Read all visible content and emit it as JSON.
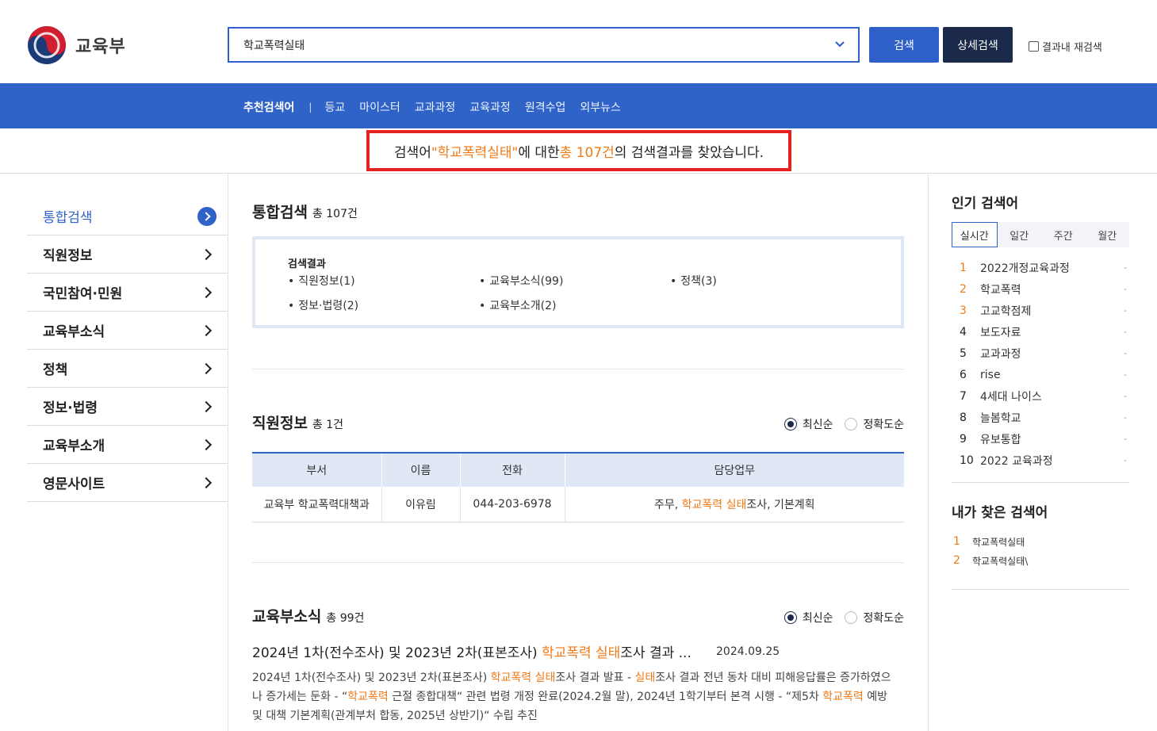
{
  "header": {
    "logo_text": "교육부",
    "search_value": "학교폭력실태",
    "search_button": "검색",
    "detail_button": "상세검색",
    "re_search_label": "결과내 재검색"
  },
  "nav": {
    "recommend_label": "추천검색어",
    "separator": "|",
    "keywords": [
      "등교",
      "마이스터",
      "교과과정",
      "교육과정",
      "원격수업",
      "외부뉴스"
    ]
  },
  "summary": {
    "prefix": "검색어 ",
    "query": "\"학교폭력실태\"",
    "mid": "에 대한 ",
    "total": "총 107건",
    "suffix": "의 검색결과를 찾았습니다."
  },
  "sidebar": {
    "items": [
      {
        "label": "통합검색"
      },
      {
        "label": "직원정보"
      },
      {
        "label": "국민참여·민원"
      },
      {
        "label": "교육부소식"
      },
      {
        "label": "정책"
      },
      {
        "label": "정보·법령"
      },
      {
        "label": "교육부소개"
      },
      {
        "label": "영문사이트"
      }
    ]
  },
  "integrated": {
    "title": "통합검색",
    "count": "총  107건",
    "box_title": "검색결과",
    "results": [
      "직원정보(1)",
      "교육부소식(99)",
      "정책(3)",
      "정보·법령(2)",
      "교육부소개(2)"
    ]
  },
  "staff": {
    "title": "직원정보",
    "count": "총  1건",
    "sort_latest": "최신순",
    "sort_accuracy": "정확도순",
    "headers": [
      "부서",
      "이름",
      "전화",
      "담당업무"
    ],
    "row": {
      "dept": "교육부 학교폭력대책과",
      "name": "이유림",
      "phone": "044-203-6978",
      "duty_pre": "주무, ",
      "duty_hl1": "학교폭력",
      "duty_sp": " ",
      "duty_hl2": "실태",
      "duty_post": "조사, 기본계획"
    }
  },
  "news": {
    "title": "교육부소식",
    "count": "총  99건",
    "sort_latest": "최신순",
    "sort_accuracy": "정확도순",
    "item_title_pre": "2024년 1차(전수조사) 및 2023년 2차(표본조사) ",
    "item_title_hl1": "학교폭력",
    "item_title_sp": " ",
    "item_title_hl2": "실태",
    "item_title_post": "조사 결과 ...",
    "item_date": "2024.09.25",
    "body_1": "2024년 1차(전수조사) 및 2023년 2차(표본조사) ",
    "body_hl1": "학교폭력",
    "body_sp1": " ",
    "body_hl2": "실태",
    "body_2": "조사 결과 발표 - ",
    "body_hl3": "실태",
    "body_3": "조사 결과 전년 동차 대비 피해응답률은 증가하였으나 증가세는 둔화 - “",
    "body_hl4": "학교폭력",
    "body_4": " 근절 종합대책“ 관련 법령 개정 완료(2024.2월 말), 2024년 1학기부터 본격 시행 - “제5차 ",
    "body_hl5": "학교폭력",
    "body_5": " 예방 및 대책 기본계획(관계부처 합동, 2025년 상반기)“ 수립 추진"
  },
  "popular": {
    "title": "인기 검색어",
    "tabs": [
      "실시간",
      "일간",
      "주간",
      "월간"
    ],
    "dash": "-",
    "items": [
      {
        "num": "1",
        "text": "2022개정교육과정"
      },
      {
        "num": "2",
        "text": "학교폭력"
      },
      {
        "num": "3",
        "text": "고교학점제"
      },
      {
        "num": "4",
        "text": "보도자료"
      },
      {
        "num": "5",
        "text": "교과과정"
      },
      {
        "num": "6",
        "text": "rise"
      },
      {
        "num": "7",
        "text": "4세대 나이스"
      },
      {
        "num": "8",
        "text": "늘봄학교"
      },
      {
        "num": "9",
        "text": "유보통합"
      },
      {
        "num": "10",
        "text": "2022 교육과정"
      }
    ]
  },
  "my_search": {
    "title": "내가 찾은 검색어",
    "items": [
      {
        "num": "1",
        "text": "학교폭력실태"
      },
      {
        "num": "2",
        "text": "학교폭력실태\\"
      }
    ]
  }
}
